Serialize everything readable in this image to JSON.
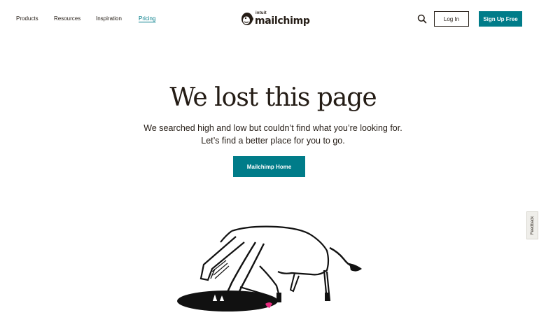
{
  "nav": {
    "links": [
      {
        "label": "Products"
      },
      {
        "label": "Resources"
      },
      {
        "label": "Inspiration"
      },
      {
        "label": "Pricing"
      }
    ],
    "active": "Pricing",
    "logo": {
      "small_text": "intuit",
      "wordmark": "mailchimp",
      "icon": "freddie-chimp-icon"
    },
    "search_icon": "search-icon",
    "login_label": "Log In",
    "signup_label": "Sign Up Free"
  },
  "hero": {
    "title": "We lost this page",
    "subtitle_line1": "We searched high and low but couldn’t find what you’re looking for.",
    "subtitle_line2": "Let’s find a better place for you to go.",
    "button_label": "Mailchimp Home",
    "illustration": "horse-looking-into-hole-illustration"
  },
  "feedback": {
    "label": "Feedback"
  },
  "colors": {
    "accent": "#007c89",
    "text": "#241c15",
    "highlight": "#e82b7f"
  }
}
